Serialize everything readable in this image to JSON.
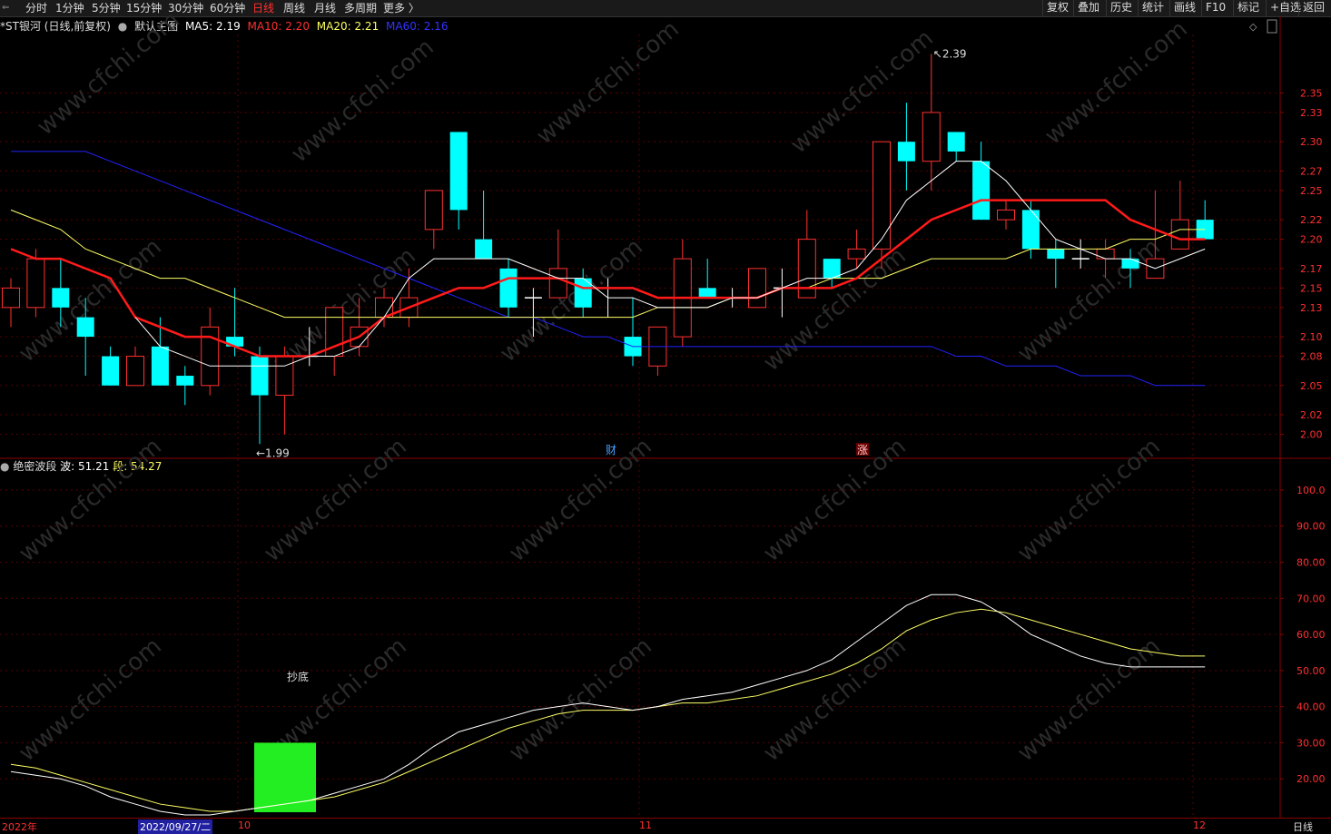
{
  "topbar": {
    "tabs": [
      "分时",
      "1分钟",
      "5分钟",
      "15分钟",
      "30分钟",
      "60分钟",
      "日线",
      "周线",
      "月线",
      "多周期",
      "更多 〉"
    ],
    "active_tab": "日线",
    "right_buttons": [
      "复权",
      "叠加",
      "历史",
      "统计",
      "画线",
      "F10",
      "标记",
      "+自选",
      "返回"
    ]
  },
  "main_panel": {
    "title": "*ST银河 (日线,前复权)",
    "template": "默认主图",
    "ma5_label": "MA5: 2.19",
    "ma10_label": "MA10: 2.20",
    "ma20_label": "MA20: 2.21",
    "ma60_label": "MA60: 2.16",
    "high_label": "2.39",
    "low_label": "1.99",
    "marker_cai": "财",
    "marker_zhang": "涨"
  },
  "sub_panel": {
    "title": "绝密波段",
    "bo_label": "波: 51.21",
    "duan_label": "段: 54.27",
    "signal_label": "抄底"
  },
  "bottombar": {
    "year_label": "2022年",
    "date_label": "2022/09/27/二",
    "oct_label": "10",
    "nov_label": "11",
    "dec_label": "12",
    "period_label": "日线"
  },
  "colors": {
    "up": "#ff3030",
    "down": "#00ffff",
    "ma5": "#ffffff",
    "ma10": "#ff1a1a",
    "ma20": "#ffff66",
    "ma60": "#2222ff",
    "signal": "#22ee22"
  },
  "watermark": "www.cfchi.com",
  "chart_data": {
    "type": "candlestick",
    "y_axis_main": [
      "2.35",
      "2.33",
      "2.30",
      "2.27",
      "2.25",
      "2.22",
      "2.20",
      "2.17",
      "2.15",
      "2.13",
      "2.10",
      "2.08",
      "2.05",
      "2.02",
      "2.00"
    ],
    "y_axis_sub": [
      "100.0",
      "90.00",
      "80.00",
      "70.00",
      "60.00",
      "50.00",
      "40.00",
      "30.00",
      "20.00"
    ],
    "ylim_main": [
      1.98,
      2.41
    ],
    "ylim_sub": [
      10,
      105
    ],
    "candles": [
      {
        "o": 2.13,
        "c": 2.15,
        "h": 2.16,
        "l": 2.11
      },
      {
        "o": 2.13,
        "c": 2.18,
        "h": 2.19,
        "l": 2.12
      },
      {
        "o": 2.15,
        "c": 2.13,
        "h": 2.18,
        "l": 2.11
      },
      {
        "o": 2.12,
        "c": 2.1,
        "h": 2.14,
        "l": 2.06
      },
      {
        "o": 2.08,
        "c": 2.05,
        "h": 2.09,
        "l": 2.05
      },
      {
        "o": 2.05,
        "c": 2.08,
        "h": 2.09,
        "l": 2.05
      },
      {
        "o": 2.09,
        "c": 2.05,
        "h": 2.12,
        "l": 2.05
      },
      {
        "o": 2.06,
        "c": 2.05,
        "h": 2.07,
        "l": 2.03
      },
      {
        "o": 2.05,
        "c": 2.11,
        "h": 2.13,
        "l": 2.04
      },
      {
        "o": 2.1,
        "c": 2.09,
        "h": 2.15,
        "l": 2.08
      },
      {
        "o": 2.08,
        "c": 2.04,
        "h": 2.09,
        "l": 1.99
      },
      {
        "o": 2.04,
        "c": 2.08,
        "h": 2.09,
        "l": 2.0
      },
      {
        "o": 2.08,
        "c": 2.08,
        "h": 2.11,
        "l": 2.07
      },
      {
        "o": 2.08,
        "c": 2.13,
        "h": 2.13,
        "l": 2.06
      },
      {
        "o": 2.09,
        "c": 2.11,
        "h": 2.14,
        "l": 2.08
      },
      {
        "o": 2.12,
        "c": 2.14,
        "h": 2.15,
        "l": 2.11
      },
      {
        "o": 2.12,
        "c": 2.14,
        "h": 2.17,
        "l": 2.11
      },
      {
        "o": 2.21,
        "c": 2.25,
        "h": 2.25,
        "l": 2.19
      },
      {
        "o": 2.31,
        "c": 2.23,
        "h": 2.31,
        "l": 2.21
      },
      {
        "o": 2.2,
        "c": 2.18,
        "h": 2.25,
        "l": 2.18
      },
      {
        "o": 2.17,
        "c": 2.13,
        "h": 2.18,
        "l": 2.12
      },
      {
        "o": 2.14,
        "c": 2.14,
        "h": 2.15,
        "l": 2.1
      },
      {
        "o": 2.14,
        "c": 2.17,
        "h": 2.21,
        "l": 2.14
      },
      {
        "o": 2.16,
        "c": 2.13,
        "h": 2.17,
        "l": 2.12
      },
      {
        "o": 2.15,
        "c": 2.15,
        "h": 2.16,
        "l": 2.12
      },
      {
        "o": 2.1,
        "c": 2.08,
        "h": 2.14,
        "l": 2.07
      },
      {
        "o": 2.07,
        "c": 2.11,
        "h": 2.11,
        "l": 2.06
      },
      {
        "o": 2.1,
        "c": 2.18,
        "h": 2.2,
        "l": 2.09
      },
      {
        "o": 2.15,
        "c": 2.14,
        "h": 2.18,
        "l": 2.14
      },
      {
        "o": 2.14,
        "c": 2.14,
        "h": 2.15,
        "l": 2.13
      },
      {
        "o": 2.13,
        "c": 2.17,
        "h": 2.17,
        "l": 2.13
      },
      {
        "o": 2.15,
        "c": 2.15,
        "h": 2.17,
        "l": 2.12
      },
      {
        "o": 2.14,
        "c": 2.2,
        "h": 2.23,
        "l": 2.14
      },
      {
        "o": 2.18,
        "c": 2.16,
        "h": 2.18,
        "l": 2.15
      },
      {
        "o": 2.18,
        "c": 2.19,
        "h": 2.21,
        "l": 2.17
      },
      {
        "o": 2.19,
        "c": 2.3,
        "h": 2.3,
        "l": 2.17
      },
      {
        "o": 2.3,
        "c": 2.28,
        "h": 2.34,
        "l": 2.25
      },
      {
        "o": 2.28,
        "c": 2.33,
        "h": 2.39,
        "l": 2.25
      },
      {
        "o": 2.31,
        "c": 2.29,
        "h": 2.31,
        "l": 2.28
      },
      {
        "o": 2.28,
        "c": 2.22,
        "h": 2.3,
        "l": 2.22
      },
      {
        "o": 2.22,
        "c": 2.23,
        "h": 2.24,
        "l": 2.21
      },
      {
        "o": 2.23,
        "c": 2.19,
        "h": 2.24,
        "l": 2.18
      },
      {
        "o": 2.19,
        "c": 2.18,
        "h": 2.2,
        "l": 2.15
      },
      {
        "o": 2.18,
        "c": 2.18,
        "h": 2.2,
        "l": 2.17
      },
      {
        "o": 2.18,
        "c": 2.19,
        "h": 2.2,
        "l": 2.16
      },
      {
        "o": 2.18,
        "c": 2.17,
        "h": 2.19,
        "l": 2.15
      },
      {
        "o": 2.16,
        "c": 2.18,
        "h": 2.25,
        "l": 2.16
      },
      {
        "o": 2.19,
        "c": 2.22,
        "h": 2.26,
        "l": 2.19
      },
      {
        "o": 2.22,
        "c": 2.2,
        "h": 2.24,
        "l": 2.2
      }
    ],
    "ma5": [
      null,
      null,
      null,
      null,
      null,
      2.12,
      2.09,
      2.08,
      2.07,
      2.07,
      2.07,
      2.07,
      2.08,
      2.08,
      2.09,
      2.12,
      2.16,
      2.18,
      2.18,
      2.18,
      2.18,
      2.17,
      2.16,
      2.16,
      2.14,
      2.14,
      2.13,
      2.13,
      2.13,
      2.14,
      2.14,
      2.15,
      2.16,
      2.16,
      2.17,
      2.2,
      2.24,
      2.26,
      2.28,
      2.28,
      2.26,
      2.23,
      2.2,
      2.19,
      2.18,
      2.18,
      2.17,
      2.18,
      2.19
    ],
    "ma10": [
      2.19,
      2.18,
      2.18,
      2.17,
      2.16,
      2.12,
      2.11,
      2.1,
      2.1,
      2.09,
      2.08,
      2.08,
      2.08,
      2.09,
      2.1,
      2.12,
      2.13,
      2.14,
      2.15,
      2.15,
      2.16,
      2.16,
      2.16,
      2.15,
      2.15,
      2.15,
      2.14,
      2.14,
      2.14,
      2.14,
      2.14,
      2.15,
      2.15,
      2.15,
      2.16,
      2.18,
      2.2,
      2.22,
      2.23,
      2.24,
      2.24,
      2.24,
      2.24,
      2.24,
      2.24,
      2.22,
      2.21,
      2.2,
      2.2
    ],
    "ma20": [
      2.23,
      2.22,
      2.21,
      2.19,
      2.18,
      2.17,
      2.16,
      2.16,
      2.15,
      2.14,
      2.13,
      2.12,
      2.12,
      2.12,
      2.12,
      2.12,
      2.12,
      2.12,
      2.12,
      2.12,
      2.12,
      2.12,
      2.12,
      2.12,
      2.12,
      2.12,
      2.13,
      2.13,
      2.13,
      2.14,
      2.14,
      2.15,
      2.15,
      2.16,
      2.16,
      2.16,
      2.17,
      2.18,
      2.18,
      2.18,
      2.18,
      2.19,
      2.19,
      2.19,
      2.19,
      2.2,
      2.2,
      2.21,
      2.21
    ],
    "ma60": [
      2.29,
      2.29,
      2.29,
      2.29,
      2.28,
      2.27,
      2.26,
      2.25,
      2.24,
      2.23,
      2.22,
      2.21,
      2.2,
      2.19,
      2.18,
      2.17,
      2.16,
      2.15,
      2.14,
      2.13,
      2.12,
      2.12,
      2.11,
      2.1,
      2.1,
      2.09,
      2.09,
      2.09,
      2.09,
      2.09,
      2.09,
      2.09,
      2.09,
      2.09,
      2.09,
      2.09,
      2.09,
      2.09,
      2.08,
      2.08,
      2.07,
      2.07,
      2.07,
      2.06,
      2.06,
      2.06,
      2.05,
      2.05,
      2.05
    ],
    "bo": [
      22,
      21,
      20,
      18,
      15,
      13,
      11,
      10,
      10,
      11,
      12,
      13,
      14,
      16,
      18,
      20,
      24,
      29,
      33,
      35,
      37,
      39,
      40,
      41,
      40,
      39,
      40,
      42,
      43,
      44,
      46,
      48,
      50,
      53,
      58,
      63,
      68,
      71,
      71,
      69,
      65,
      60,
      57,
      54,
      52,
      51,
      51,
      51,
      51
    ],
    "duan": [
      24,
      23,
      21,
      19,
      17,
      15,
      13,
      12,
      11,
      11,
      12,
      13,
      14,
      15,
      17,
      19,
      22,
      25,
      28,
      31,
      34,
      36,
      38,
      39,
      39,
      39,
      40,
      41,
      41,
      42,
      43,
      45,
      47,
      49,
      52,
      56,
      61,
      64,
      66,
      67,
      66,
      64,
      62,
      60,
      58,
      56,
      55,
      54,
      54
    ],
    "signal_bar": {
      "index": 10,
      "value": 30
    }
  }
}
